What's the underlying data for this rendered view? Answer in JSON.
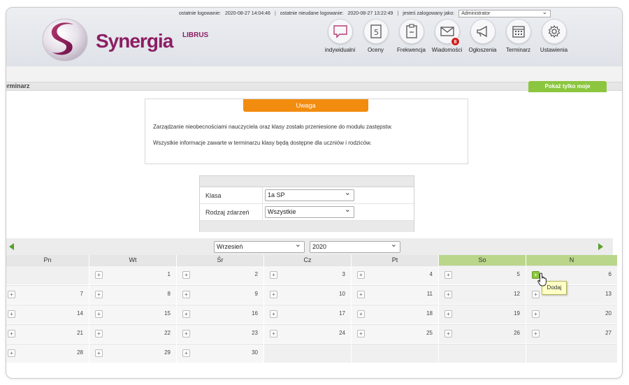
{
  "header": {
    "last_login_label": "ostatnie logowanie:",
    "last_login_value": "2020-08-27 14:04:46",
    "failed_login_label": "ostatnie nieudane logowanie:",
    "failed_login_value": "2020-08-27 13:22:49",
    "logged_as_label": "jesteś zalogowany jako:",
    "role": "Administrator",
    "logo_small": "LIBRUS",
    "logo_big": "Synergia"
  },
  "nav": [
    {
      "label": "indywidualni",
      "icon": "speech-bubble-icon"
    },
    {
      "label": "Oceny",
      "icon": "grade-card-icon"
    },
    {
      "label": "Frekwencja",
      "icon": "attendance-clipboard-icon"
    },
    {
      "label": "Wiadomości",
      "icon": "envelope-icon",
      "badge": "8"
    },
    {
      "label": "Ogłoszenia",
      "icon": "megaphone-icon"
    },
    {
      "label": "Terminarz",
      "icon": "calendar-icon"
    },
    {
      "label": "Ustawienia",
      "icon": "gear-icon"
    }
  ],
  "page": {
    "title": "erminarz",
    "show_mine_button": "Pokaż tylko moje"
  },
  "notice": {
    "heading": "Uwaga",
    "paragraph1": "Zarządzanie nieobecnościami nauczyciela oraz klasy zostało przeniesione do modułu zastępstw.",
    "paragraph2": "Wszystkie informacje zawarte w terminarzu klasy będą dostępne dla uczniów i rodziców."
  },
  "filter": {
    "class_label": "Klasa",
    "class_value": "1a SP",
    "event_type_label": "Rodzaj zdarzeń",
    "event_type_value": "Wszystkie"
  },
  "calendar": {
    "month": "Wrzesień",
    "year": "2020",
    "weekdays": [
      "Pn",
      "Wt",
      "Śr",
      "Cz",
      "Pt",
      "So",
      "N"
    ],
    "weeks": [
      [
        "",
        "1",
        "2",
        "3",
        "4",
        "5",
        "6"
      ],
      [
        "7",
        "8",
        "9",
        "10",
        "11",
        "12",
        "13"
      ],
      [
        "14",
        "15",
        "16",
        "17",
        "18",
        "19",
        "20"
      ],
      [
        "21",
        "22",
        "23",
        "24",
        "25",
        "26",
        "27"
      ],
      [
        "28",
        "29",
        "30",
        "",
        "",
        "",
        ""
      ]
    ],
    "add_symbol": "+",
    "tooltip": "Dodaj"
  },
  "colors": {
    "accent_green": "#8cc63f",
    "notice_orange": "#f28c0f",
    "brand_purple": "#8c1e63",
    "badge_red": "#d01f1f"
  }
}
